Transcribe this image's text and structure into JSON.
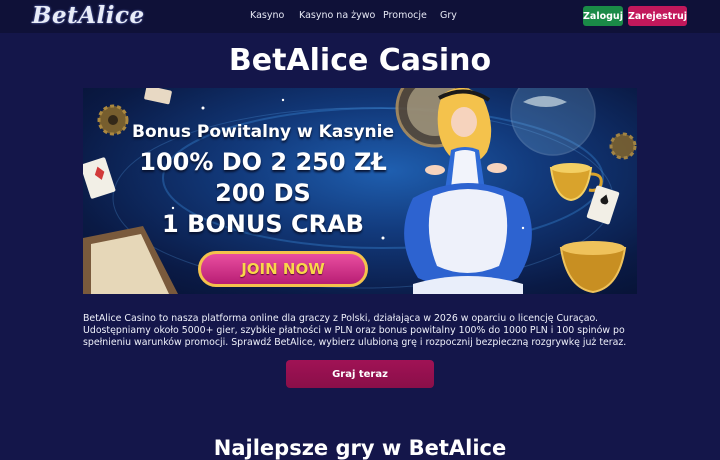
{
  "header": {
    "logo": "BetAlice",
    "nav": [
      {
        "label": "Kasyno"
      },
      {
        "label": "Kasyno na żywo"
      },
      {
        "label": "Promocje"
      },
      {
        "label": "Gry"
      }
    ],
    "login_label": "Zaloguj",
    "register_label": "Zarejestruj"
  },
  "main": {
    "title": "BetAlice Casino",
    "banner": {
      "line1": "Bonus Powitalny w Kasynie",
      "line2": "100% DO 2 250 ZŁ",
      "line3": "200 DS",
      "line4": "1 BONUS CRAB",
      "cta": "JOIN NOW"
    },
    "description": "BetAlice Casino to nasza platforma online dla graczy z Polski, działająca w 2026 w oparciu o licencję Curaçao. Udostępniamy około 5000+ gier, szybkie płatności w PLN oraz bonus powitalny 100% do 1000 PLN i 100 spinów po spełnieniu warunków promocji. Sprawdź BetAlice, wybierz ulubioną grę i rozpocznij bezpieczną rozgrywkę już teraz.",
    "play_label": "Graj teraz",
    "section_title": "Najlepsze gry w BetAlice"
  },
  "colors": {
    "background": "#14164a",
    "header": "#0f1138",
    "login": "#1a8a47",
    "register": "#c2185b",
    "play": "#8a0f49"
  }
}
